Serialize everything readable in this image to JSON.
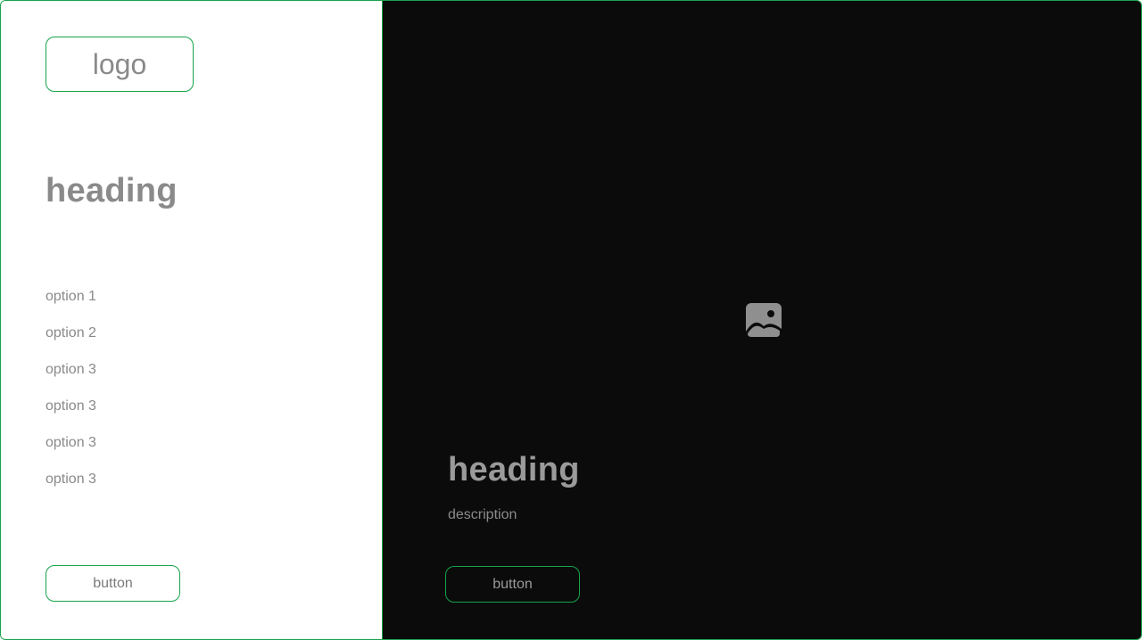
{
  "sidebar": {
    "logo": "logo",
    "heading": "heading",
    "options": [
      "option 1",
      "option 2",
      "option 3",
      "option 3",
      "option 3",
      "option 3"
    ],
    "button_label": "button"
  },
  "hero": {
    "image_icon": "image-icon",
    "heading": "heading",
    "description": "description",
    "button_label": "button"
  },
  "colors": {
    "accent": "#16a34a",
    "dark_background": "#0b0b0b",
    "light_background": "#ffffff",
    "text_gray": "#8a8a8a"
  }
}
